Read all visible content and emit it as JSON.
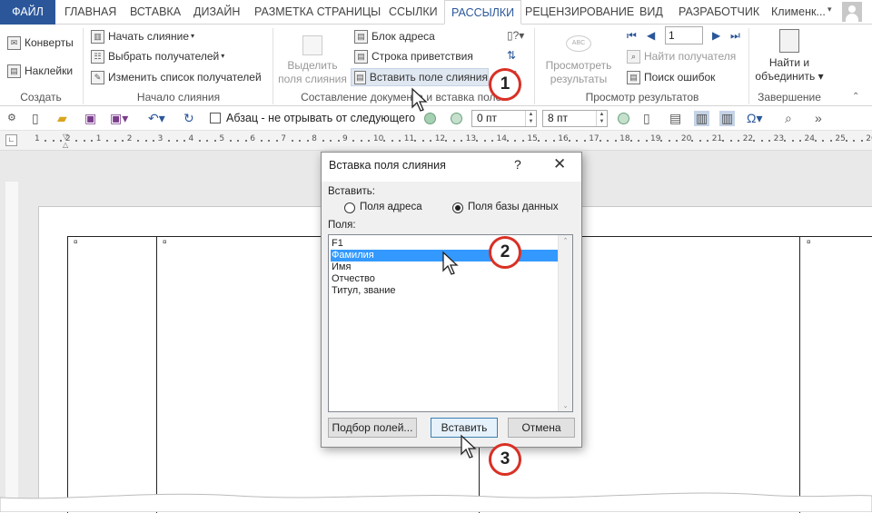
{
  "tabs": [
    {
      "label": "ФАЙЛ"
    },
    {
      "label": "ГЛАВНАЯ"
    },
    {
      "label": "ВСТАВКА"
    },
    {
      "label": "ДИЗАЙН"
    },
    {
      "label": "РАЗМЕТКА СТРАНИЦЫ"
    },
    {
      "label": "ССЫЛКИ"
    },
    {
      "label": "РАССЫЛКИ"
    },
    {
      "label": "РЕЦЕНЗИРОВАНИЕ"
    },
    {
      "label": "ВИД"
    },
    {
      "label": "РАЗРАБОТЧИК"
    }
  ],
  "user": {
    "name": "Клименк..."
  },
  "ribbon": {
    "create": {
      "label": "Создать",
      "envelopes": "Конверты",
      "labels": "Наклейки"
    },
    "start": {
      "label": "Начало слияния",
      "start_merge": "Начать слияние",
      "select_recipients": "Выбрать получателей",
      "edit_list": "Изменить список получателей"
    },
    "compose": {
      "label": "Составление документа и вставка полей",
      "highlight_l1": "Выделить",
      "highlight_l2": "поля слияния",
      "address_block": "Блок адреса",
      "greeting_line": "Строка приветствия",
      "insert_field": "Вставить поле слияния"
    },
    "preview": {
      "label": "Просмотр результатов",
      "preview_l1": "Просмотреть",
      "preview_l2": "результаты",
      "record": "1",
      "find_recipient": "Найти получателя",
      "check_errors": "Поиск ошибок"
    },
    "finish": {
      "label": "Завершение",
      "finish_l1": "Найти и",
      "finish_l2": "объединить"
    }
  },
  "qat": {
    "keep_with_next": "Абзац - не отрывать от следующего",
    "space_before": "0 пт",
    "space_after": "8 пт"
  },
  "ruler": {
    "numbers": [
      "1",
      "2",
      "1",
      "2",
      "3",
      "4",
      "5",
      "6",
      "7",
      "8",
      "9",
      "10",
      "11",
      "12",
      "13",
      "14",
      "15",
      "16",
      "17",
      "18",
      "19",
      "20",
      "21",
      "22",
      "23",
      "24",
      "25",
      "26"
    ]
  },
  "dialog": {
    "title": "Вставка поля слияния",
    "help": "?",
    "insert_label": "Вставить:",
    "opt_address": "Поля адреса",
    "opt_database": "Поля базы данных",
    "fields_label": "Поля:",
    "fields": [
      "F1",
      "Фамилия",
      "Имя",
      "Отчество",
      "Титул, звание"
    ],
    "selected_index": 1,
    "btn_match": "Подбор полей...",
    "btn_insert": "Вставить",
    "btn_cancel": "Отмена"
  },
  "callouts": {
    "c1": "1",
    "c2": "2",
    "c3": "3"
  },
  "colors": {
    "accent": "#2b579a",
    "callout": "#d93025",
    "selection": "#3399ff"
  }
}
